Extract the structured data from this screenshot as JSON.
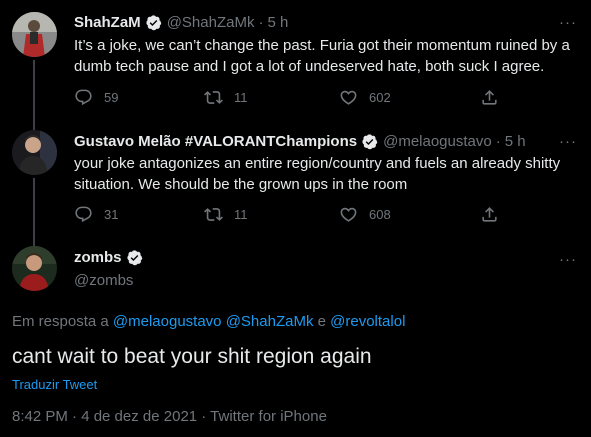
{
  "tweets": [
    {
      "name": "ShahZaM",
      "handle": "@ShahZaMk",
      "time": "5 h",
      "text": "It’s a joke, we can’t change the past. Furia got their momentum ruined by a dumb tech pause and I got a lot of undeserved hate, both suck I agree.",
      "replies": "59",
      "retweets": "11",
      "likes": "602"
    },
    {
      "name": "Gustavo Melão #VALORANTChampions",
      "handle": "@melaogustavo",
      "time": "5 h",
      "text": "your joke antagonizes an entire region/country and fuels an already shitty situation. We should be the grown ups in the room",
      "replies": "31",
      "retweets": "11",
      "likes": "608"
    }
  ],
  "focus": {
    "name": "zombs",
    "handle": "@zombs",
    "reply_prefix": "Em resposta a",
    "reply_users": [
      "@melaogustavo",
      "@ShahZaMk",
      "@revoltalol"
    ],
    "reply_conj": "e",
    "text": "cant wait to beat your shit region again",
    "translate": "Traduzir Tweet",
    "timestamp": "8:42 PM · 4 de dez de 2021 · Twitter for iPhone"
  },
  "separator": "·",
  "colors": {
    "background": "#000000",
    "text": "#e7e9ea",
    "muted": "#71767b",
    "link": "#1d9bf0",
    "verified": "#1d9bf0"
  },
  "icons": [
    "verified-badge-icon",
    "more-icon",
    "reply-icon",
    "retweet-icon",
    "like-icon",
    "share-icon"
  ]
}
